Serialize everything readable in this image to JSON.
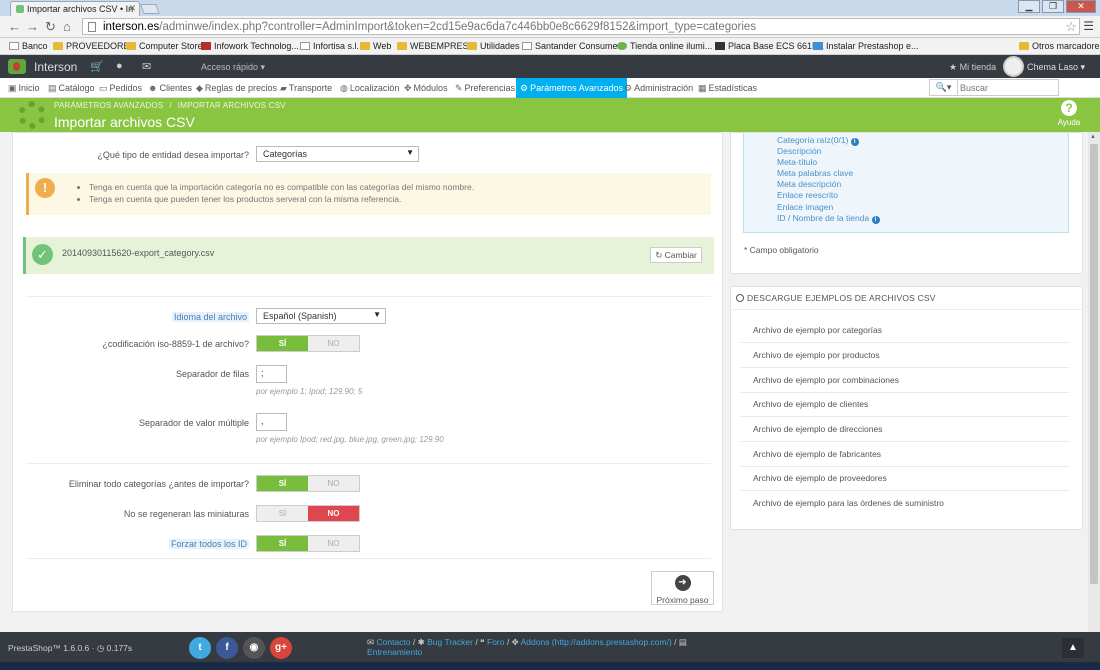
{
  "browser": {
    "tab_title": "Importar archivos CSV • In",
    "url_host": "interson.es",
    "url_path": "/adminwe/index.php?controller=AdminImport&token=2cd15e9ac6da7c446bb0e8c6629f8152&import_type=categories",
    "bookmarks": [
      "Banco",
      "PROVEEDORES",
      "Computer Store",
      "Infowork Technolog...",
      "Infortisa s.l.",
      "Web",
      "WEBEMPRESA",
      "Utilidades",
      "Santander Consumer",
      "Tienda online ilumi...",
      "Placa Base ECS 661F...",
      "Instalar Prestashop e...",
      "Otros marcadores"
    ]
  },
  "header": {
    "brand": "Interson",
    "quick_access": "Acceso rápido ▾",
    "my_store": "Mi tienda",
    "user": "Chema Laso ▾"
  },
  "nav": {
    "items": [
      "Inicio",
      "Catálogo",
      "Pedidos",
      "Clientes",
      "Reglas de precios",
      "Transporte",
      "Localización",
      "Módulos",
      "Preferencias",
      "Parámetros Avanzados",
      "Administración",
      "Estadísticas"
    ],
    "search_placeholder": "Buscar"
  },
  "toolbar": {
    "breadcrumb": [
      "PARÁMETROS AVANZADOS",
      "IMPORTAR ARCHIVOS CSV"
    ],
    "title": "Importar archivos CSV",
    "help": "Ayuda"
  },
  "form": {
    "entity_label": "¿Qué tipo de entidad desea importar?",
    "entity_value": "Categorías",
    "warnings": [
      "Tenga en cuenta que la importación categoría no es compatible con las categorías del mismo nombre.",
      "Tenga en cuenta que pueden tener los productos serveral con la misma referencia."
    ],
    "file_name": "20140930115620-export_category.csv",
    "change_button": "Cambiar",
    "language_label": "Idioma del archivo",
    "language_value": "Español (Spanish)",
    "iso_label": "¿codificación iso-8859-1 de archivo?",
    "yes": "SÍ",
    "no": "NO",
    "row_sep_label": "Separador de filas",
    "row_sep_value": ";",
    "row_sep_example": "por ejemplo 1; Ipod; 129.90; 5",
    "multi_sep_label": "Separador de valor múltiple",
    "multi_sep_value": ",",
    "multi_sep_example": "por ejemplo Ipod; red.jpg, blue.jpg, green.jpg; 129.90",
    "delete_label": "Eliminar todo categorías ¿antes de importar?",
    "regen_label": "No se regeneran las miniaturas",
    "force_ids_label": "Forzar todos los ID",
    "next_button": "Próximo paso"
  },
  "fields": {
    "items": [
      "Categoría raíz(0/1)",
      "Descripción",
      "Meta-título",
      "Meta palabras clave",
      "Meta descripción",
      "Enlace reescrito",
      "Enlace imagen",
      "ID / Nombre de la tienda"
    ],
    "required_note": "* Campo obligatorio"
  },
  "samples": {
    "heading": "DESCARGUE EJEMPLOS DE ARCHIVOS CSV",
    "items": [
      "Archivo de ejemplo por categorías",
      "Archivo de ejemplo por productos",
      "Archivo de ejemplo por combinaciones",
      "Archivo de ejemplo de clientes",
      "Archivo de ejemplo de direcciones",
      "Archivo de ejemplo de fabricantes",
      "Archivo de ejemplo de proveedores",
      "Archivo de ejemplo para las órdenes de suministro"
    ]
  },
  "footer": {
    "version": "PrestaShop™ 1.6.0.6 · ",
    "time": "0.177s",
    "contact": "Contacto",
    "bug": "Bug Tracker",
    "forum": "Foro",
    "addons": "Addons (http://addons.prestashop.com/)",
    "training": "Entrenamiento"
  },
  "colors": {
    "toolbar_green": "#8ac542",
    "nav_active": "#00aff0",
    "switch_on": "#79bd3c",
    "switch_off": "#e0464d",
    "warning": "#f0ad4e",
    "success": "#72c279"
  }
}
